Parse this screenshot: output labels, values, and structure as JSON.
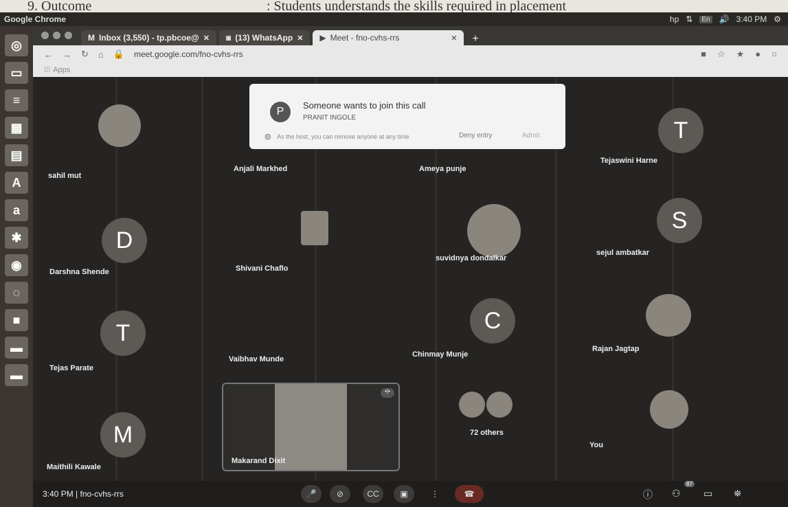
{
  "paper": {
    "outcome_label": "9. Outcome",
    "outcome_text": ": Students understands the skills required in placement"
  },
  "os": {
    "app_name": "Google Chrome",
    "lang": "En",
    "time": "3:40 PM"
  },
  "browser": {
    "tabs": [
      {
        "label": "Inbox (3,550) - tp.pbcoe@",
        "icon": "gmail-icon"
      },
      {
        "label": "(13) WhatsApp",
        "icon": "whatsapp-icon"
      },
      {
        "label": "Meet - fno-cvhs-rrs",
        "icon": "meet-icon"
      }
    ],
    "url": "meet.google.com/fno-cvhs-rrs",
    "bookmarks_label": "Apps"
  },
  "popup": {
    "avatar": "P",
    "title": "Someone wants to join this call",
    "name": "PRANIT INGOLE",
    "note": "As the host, you can remove anyone at any time",
    "deny": "Deny entry",
    "admit": "Admit"
  },
  "participants": {
    "sahil": "sahil mut",
    "anjali": "Anjali Markhed",
    "ameya": "Ameya punje",
    "tejaswini": {
      "initial": "T",
      "name": "Tejaswini Harne"
    },
    "darshna": {
      "initial": "D",
      "name": "Darshna Shende"
    },
    "shivani": "Shivani Chaflo",
    "suvidnya": "suvidnya dondalkar",
    "sejul": {
      "initial": "S",
      "name": "sejul ambatkar"
    },
    "tejas": {
      "initial": "T",
      "name": "Tejas Parate"
    },
    "vaibhav": "Vaibhav Munde",
    "chinmay": {
      "initial": "C",
      "name": "Chinmay Munje"
    },
    "rajan": "Rajan Jagtap",
    "maithili": {
      "initial": "M",
      "name": "Maithili Kawale"
    },
    "makarand": "Makarand Dixit",
    "others": "72 others",
    "you": "You"
  },
  "controls": {
    "time": "3:40 PM",
    "separator": "|",
    "meeting_code": "fno-cvhs-rrs",
    "participants_badge": "87"
  }
}
